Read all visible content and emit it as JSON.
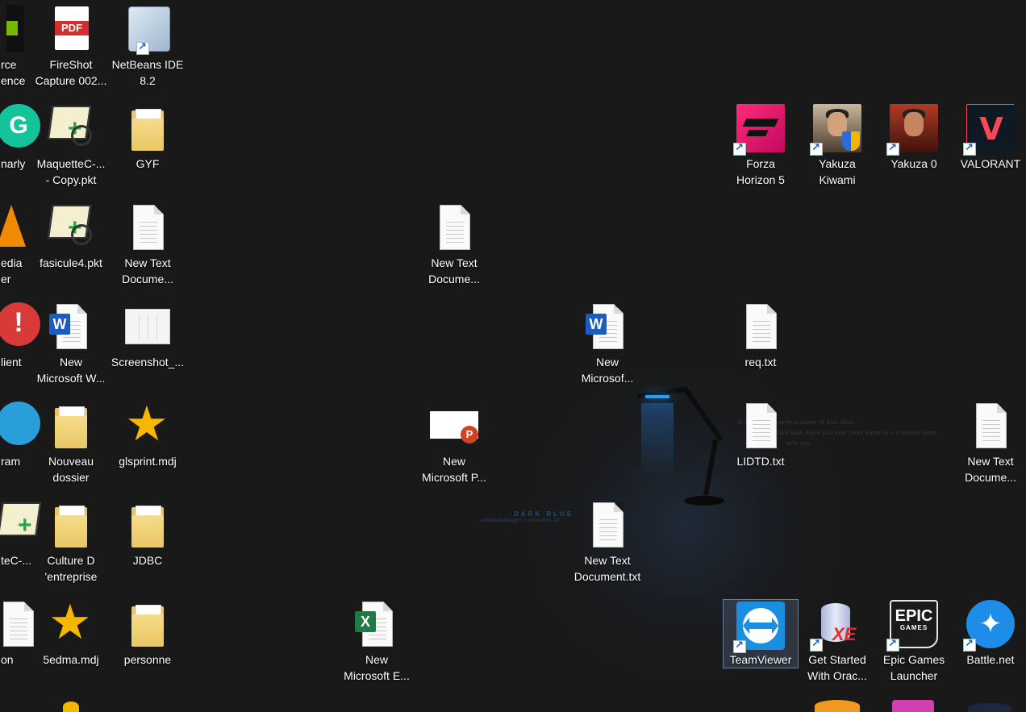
{
  "desktop": {
    "wallpaper": {
      "title": "DARK BLUE",
      "credit": "solidwebdesigns | collection 18",
      "lyric1": "Sl          rs nights a perfect shade of dark blue...",
      "lyric2": "dark blue, have you ever been alone in a crowded room",
      "lyric3": "with you",
      "accent_color": "#1a8fe0"
    },
    "icons": [
      {
        "label": "rce\nence",
        "icon": "nvidia-icon"
      },
      {
        "label": "FireShot\nCapture 002...",
        "icon": "pdf-icon"
      },
      {
        "label": "NetBeans IDE\n8.2",
        "icon": "netbeans-icon"
      },
      {
        "label": "narly",
        "icon": "grammarly-icon"
      },
      {
        "label": "MaquetteC-...\n- Copy.pkt",
        "icon": "packet-tracer-icon"
      },
      {
        "label": "GYF",
        "icon": "folder-icon"
      },
      {
        "label": "edia\ner",
        "icon": "vlc-icon"
      },
      {
        "label": "fasicule4.pkt",
        "icon": "packet-tracer-icon"
      },
      {
        "label": "New Text\nDocume...",
        "icon": "text-document-icon"
      },
      {
        "label": "lient",
        "icon": "client-icon"
      },
      {
        "label": "New\nMicrosoft W...",
        "icon": "word-icon"
      },
      {
        "label": "Screenshot_...",
        "icon": "image-icon"
      },
      {
        "label": "ram",
        "icon": "telegram-icon"
      },
      {
        "label": "Nouveau\ndossier",
        "icon": "folder-icon"
      },
      {
        "label": "glsprint.mdj",
        "icon": "staruml-icon"
      },
      {
        "label": "teC-...",
        "icon": "packet-tracer-icon"
      },
      {
        "label": "Culture D\n'entreprise",
        "icon": "folder-icon"
      },
      {
        "label": "JDBC",
        "icon": "folder-icon"
      },
      {
        "label": "on",
        "icon": "text-document-icon"
      },
      {
        "label": "5edma.mdj",
        "icon": "staruml-icon"
      },
      {
        "label": "personne",
        "icon": "folder-icon"
      },
      {
        "label": "New Text\nDocume...",
        "icon": "text-document-icon"
      },
      {
        "label": "New\nMicrosof...",
        "icon": "word-icon"
      },
      {
        "label": "req.txt",
        "icon": "text-document-icon"
      },
      {
        "label": "New\nMicrosoft P...",
        "icon": "powerpoint-icon"
      },
      {
        "label": "LIDTD.txt",
        "icon": "text-document-icon"
      },
      {
        "label": "New Text\nDocume...",
        "icon": "text-document-icon"
      },
      {
        "label": "New Text\nDocument.txt",
        "icon": "text-document-icon"
      },
      {
        "label": "New\nMicrosoft E...",
        "icon": "excel-icon"
      },
      {
        "label": "Forza\nHorizon 5",
        "icon": "forza-icon"
      },
      {
        "label": "Yakuza\nKiwami",
        "icon": "yakuza-kiwami-icon"
      },
      {
        "label": "Yakuza 0",
        "icon": "yakuza-0-icon"
      },
      {
        "label": "VALORANT",
        "icon": "valorant-icon"
      },
      {
        "label": "TeamViewer",
        "icon": "teamviewer-icon",
        "selected": true
      },
      {
        "label": "Get Started\nWith Orac...",
        "icon": "oracle-xe-icon"
      },
      {
        "label": "Epic Games\nLauncher",
        "icon": "epic-games-icon"
      },
      {
        "label": "Battle.net",
        "icon": "battlenet-icon"
      }
    ]
  }
}
